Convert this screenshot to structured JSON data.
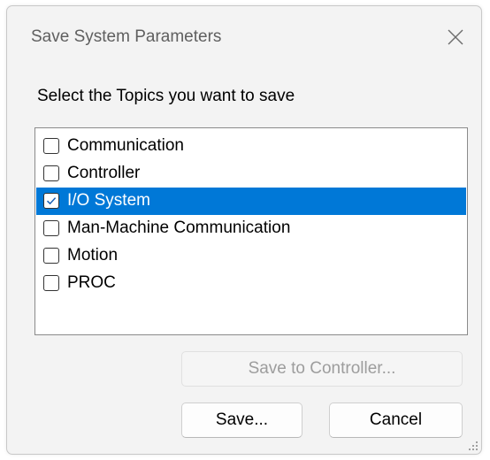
{
  "window": {
    "title": "Save System Parameters",
    "close_icon": "close-icon"
  },
  "instruction": "Select the Topics you want to save",
  "topics": [
    {
      "label": "Communication",
      "checked": false,
      "selected": false
    },
    {
      "label": "Controller",
      "checked": false,
      "selected": false
    },
    {
      "label": "I/O System",
      "checked": true,
      "selected": true
    },
    {
      "label": "Man-Machine Communication",
      "checked": false,
      "selected": false
    },
    {
      "label": "Motion",
      "checked": false,
      "selected": false
    },
    {
      "label": "PROC",
      "checked": false,
      "selected": false
    }
  ],
  "buttons": {
    "save_to_controller": "Save to Controller...",
    "save": "Save...",
    "cancel": "Cancel"
  },
  "colors": {
    "selection": "#0078d7",
    "dialog_bg": "#f3f3f3",
    "disabled_text": "#9d9d9d"
  }
}
